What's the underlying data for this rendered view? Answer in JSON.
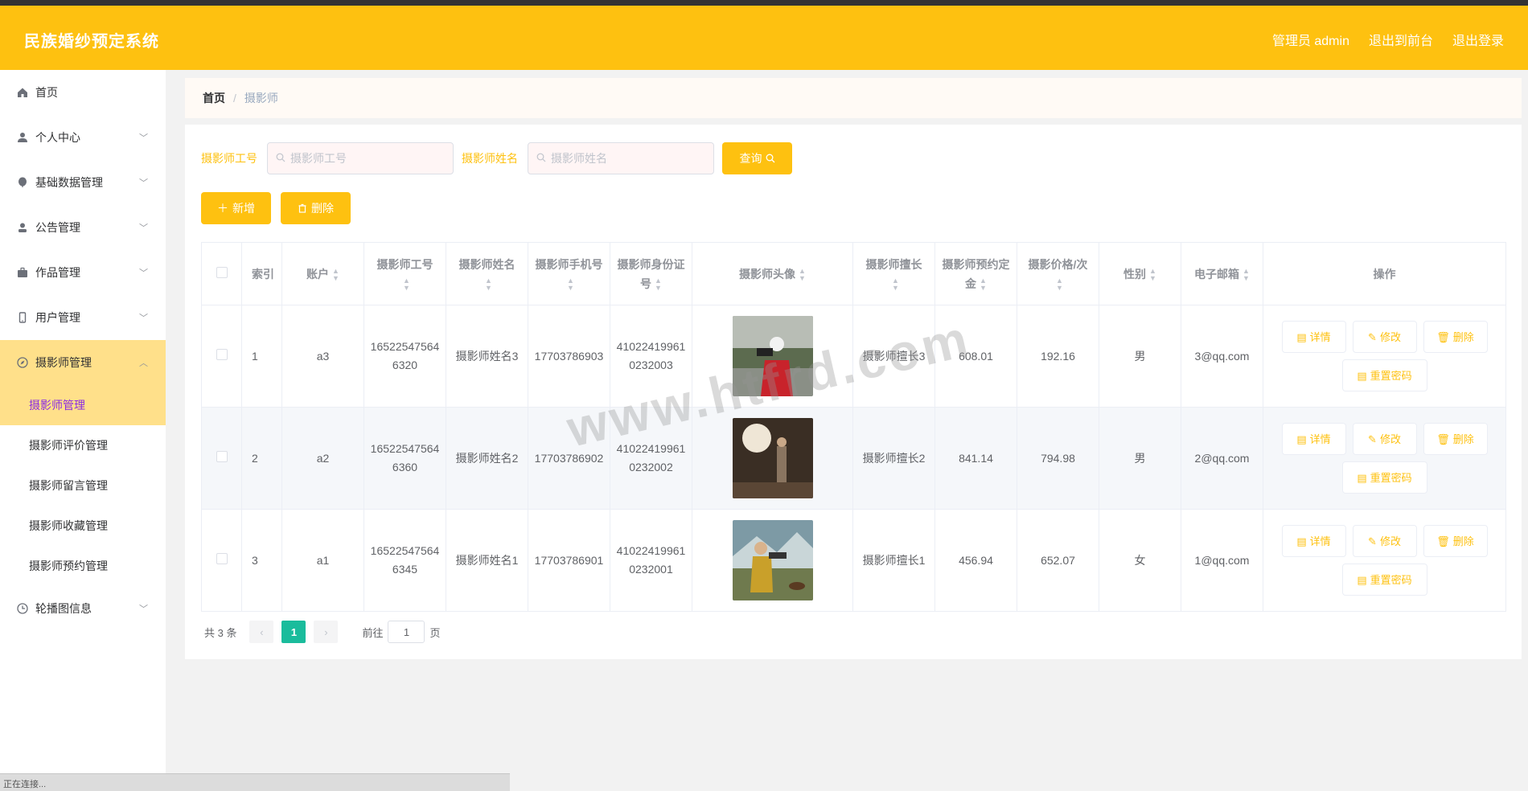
{
  "header": {
    "title": "民族婚纱预定系统",
    "admin": "管理员 admin",
    "to_front": "退出到前台",
    "logout": "退出登录"
  },
  "sidebar": {
    "items": [
      {
        "label": "首页",
        "icon": "home-icon"
      },
      {
        "label": "个人中心",
        "icon": "user-icon"
      },
      {
        "label": "基础数据管理",
        "icon": "balloon-icon"
      },
      {
        "label": "公告管理",
        "icon": "person-icon"
      },
      {
        "label": "作品管理",
        "icon": "briefcase-icon"
      },
      {
        "label": "用户管理",
        "icon": "phone-icon"
      },
      {
        "label": "摄影师管理",
        "icon": "compass-icon"
      },
      {
        "label": "轮播图信息",
        "icon": "clock-icon"
      }
    ],
    "sub_items": [
      "摄影师管理",
      "摄影师评价管理",
      "摄影师留言管理",
      "摄影师收藏管理",
      "摄影师预约管理"
    ]
  },
  "breadcrumb": {
    "home": "首页",
    "sep": "/",
    "current": "摄影师"
  },
  "search": {
    "label_no": "摄影师工号",
    "placeholder_no": "摄影师工号",
    "label_name": "摄影师姓名",
    "placeholder_name": "摄影师姓名",
    "query_button": "查询"
  },
  "actions": {
    "add": "新增",
    "delete": "删除"
  },
  "table": {
    "headers": {
      "index": "索引",
      "account": "账户",
      "no": "摄影师工号",
      "name": "摄影师姓名",
      "phone": "摄影师手机号",
      "idcard": "摄影师身份证号",
      "avatar": "摄影师头像",
      "specialty": "摄影师擅长",
      "deposit": "摄影师预约定金",
      "price": "摄影价格/次",
      "gender": "性别",
      "email": "电子邮箱",
      "ops": "操作"
    },
    "rows": [
      {
        "index": "1",
        "account": "a3",
        "no": "165225475646320",
        "name": "摄影师姓名3",
        "phone": "17703786903",
        "idcard": "410224199610232003",
        "specialty": "摄影师擅长3",
        "deposit": "608.01",
        "price": "192.16",
        "gender": "男",
        "email": "3@qq.com"
      },
      {
        "index": "2",
        "account": "a2",
        "no": "165225475646360",
        "name": "摄影师姓名2",
        "phone": "17703786902",
        "idcard": "410224199610232002",
        "specialty": "摄影师擅长2",
        "deposit": "841.14",
        "price": "794.98",
        "gender": "男",
        "email": "2@qq.com"
      },
      {
        "index": "3",
        "account": "a1",
        "no": "165225475646345",
        "name": "摄影师姓名1",
        "phone": "17703786901",
        "idcard": "410224199610232001",
        "specialty": "摄影师擅长1",
        "deposit": "456.94",
        "price": "652.07",
        "gender": "女",
        "email": "1@qq.com"
      }
    ],
    "op_labels": {
      "detail": "详情",
      "edit": "修改",
      "delete": "删除",
      "reset": "重置密码"
    }
  },
  "pagination": {
    "total": "共 3 条",
    "page": "1",
    "goto_prefix": "前往",
    "goto_value": "1",
    "goto_suffix": "页"
  },
  "watermark": "www.htfrd.com",
  "status_bar": "正在连接...",
  "colors": {
    "accent": "#fec110",
    "active_bg": "#ffe08a",
    "page_active": "#1abc9c"
  }
}
